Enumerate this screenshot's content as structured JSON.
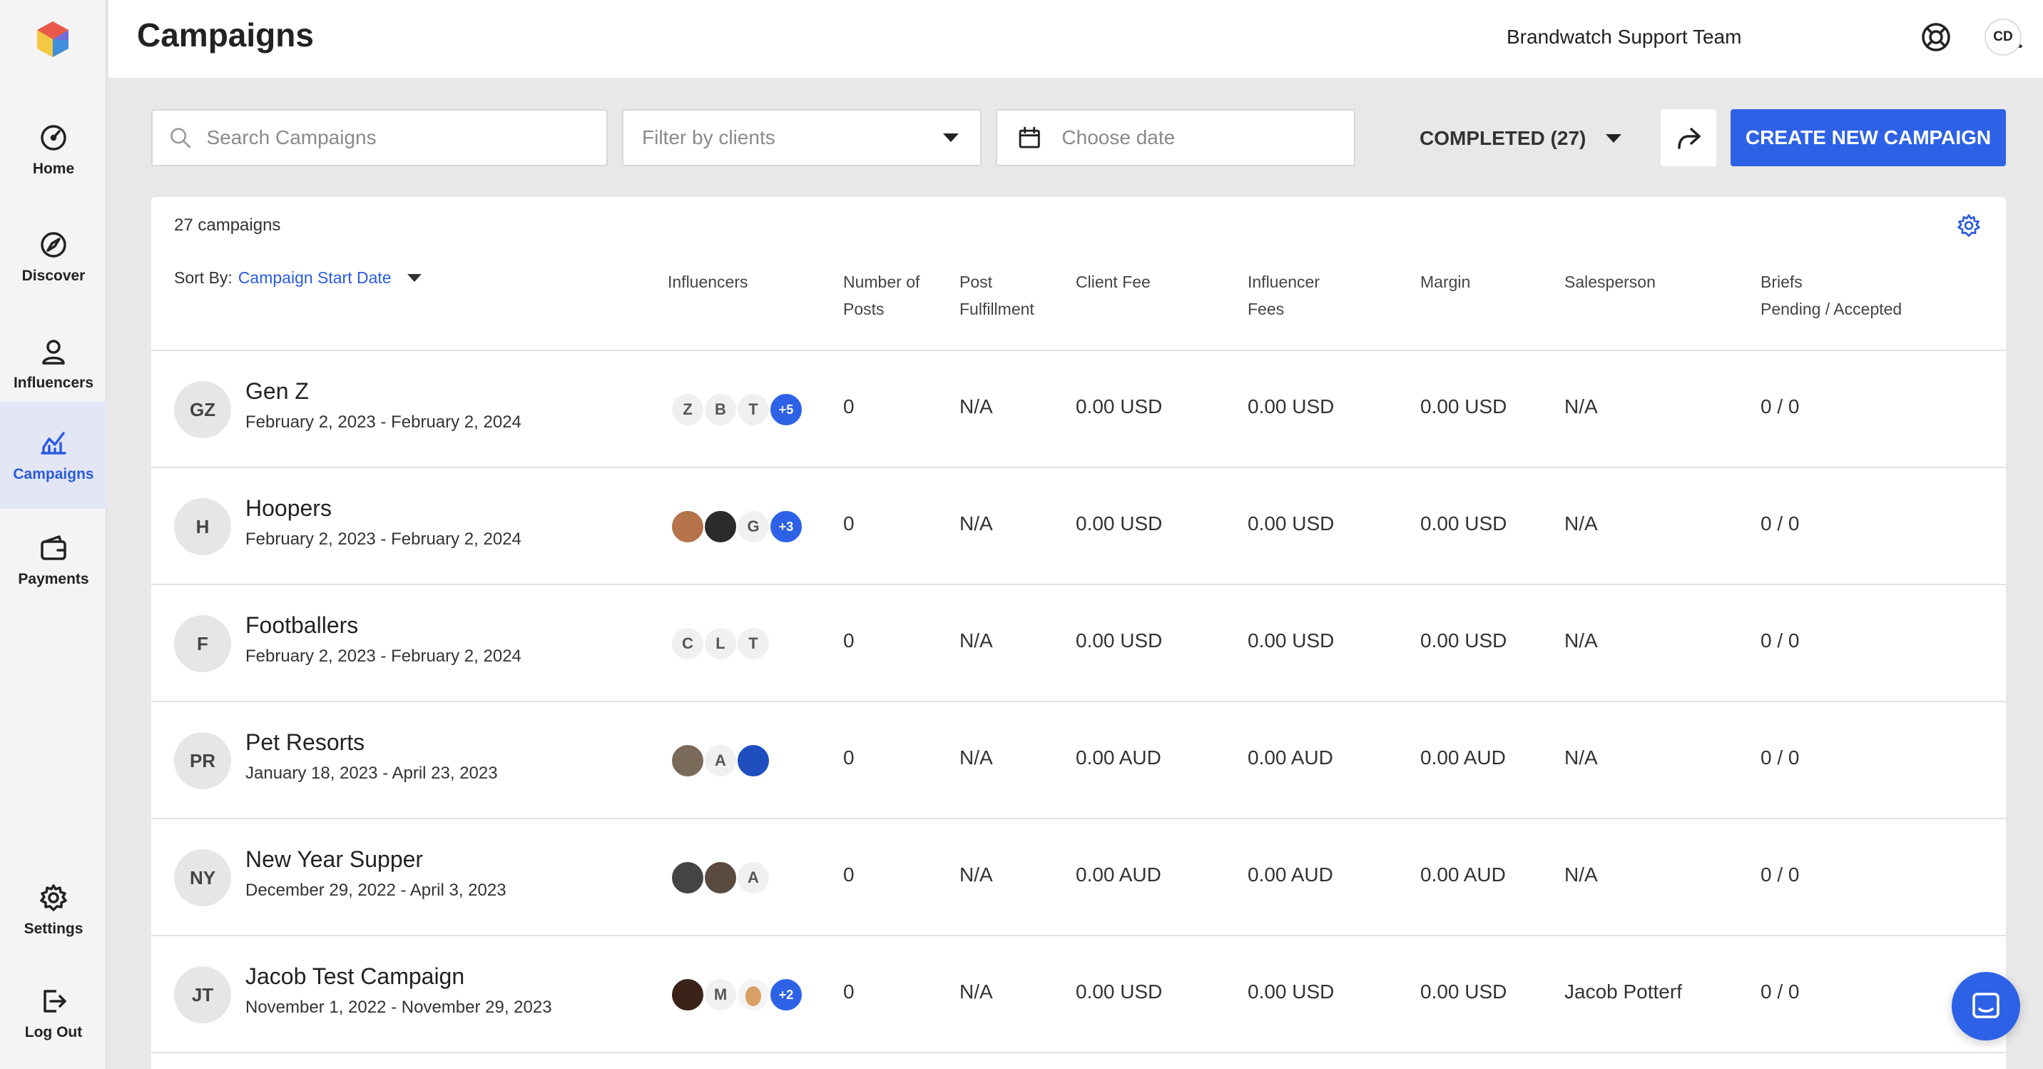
{
  "colors": {
    "accent": "#2e62e6",
    "sidebar_active_bg": "#e2e6f5"
  },
  "sidebar": {
    "items": [
      {
        "label": "Home",
        "icon": "home-icon"
      },
      {
        "label": "Discover",
        "icon": "discover-icon"
      },
      {
        "label": "Influencers",
        "icon": "influencers-icon"
      },
      {
        "label": "Campaigns",
        "icon": "campaigns-icon",
        "active": true
      },
      {
        "label": "Payments",
        "icon": "wallet-icon"
      },
      {
        "label": "Settings",
        "icon": "settings-icon"
      },
      {
        "label": "Log Out",
        "icon": "logout-icon"
      }
    ]
  },
  "header": {
    "title": "Campaigns",
    "team": "Brandwatch Support Team",
    "user_initials": "CD"
  },
  "filters": {
    "search_placeholder": "Search Campaigns",
    "client_placeholder": "Filter by clients",
    "date_placeholder": "Choose date",
    "status": "COMPLETED (27)",
    "create_label": "CREATE NEW CAMPAIGN"
  },
  "table": {
    "count": "27 campaigns",
    "sort_label": "Sort By:",
    "sort_value": "Campaign Start Date",
    "columns": {
      "influencers": "Influencers",
      "posts_1": "Number of",
      "posts_2": "Posts",
      "fulfill_1": "Post",
      "fulfill_2": "Fulfillment",
      "client_fee": "Client Fee",
      "infl_fees_1": "Influencer",
      "infl_fees_2": "Fees",
      "margin": "Margin",
      "salesperson": "Salesperson",
      "briefs_1": "Briefs",
      "briefs_2": "Pending / Accepted"
    },
    "rows": [
      {
        "initials": "GZ",
        "name": "Gen Z",
        "dates": "February 2, 2023 - February 2, 2024",
        "influencers": [
          "Z",
          "B",
          "T",
          "+5"
        ],
        "posts": "0",
        "fulfillment": "N/A",
        "client_fee": "0.00 USD",
        "influencer_fees": "0.00 USD",
        "margin": "0.00 USD",
        "salesperson": "N/A",
        "briefs": "0 / 0"
      },
      {
        "initials": "H",
        "name": "Hoopers",
        "dates": "February 2, 2023 - February 2, 2024",
        "influencers": [
          "",
          "",
          "G",
          "+3"
        ],
        "posts": "0",
        "fulfillment": "N/A",
        "client_fee": "0.00 USD",
        "influencer_fees": "0.00 USD",
        "margin": "0.00 USD",
        "salesperson": "N/A",
        "briefs": "0 / 0"
      },
      {
        "initials": "F",
        "name": "Footballers",
        "dates": "February 2, 2023 - February 2, 2024",
        "influencers": [
          "C",
          "L",
          "T"
        ],
        "posts": "0",
        "fulfillment": "N/A",
        "client_fee": "0.00 USD",
        "influencer_fees": "0.00 USD",
        "margin": "0.00 USD",
        "salesperson": "N/A",
        "briefs": "0 / 0"
      },
      {
        "initials": "PR",
        "name": "Pet Resorts",
        "dates": "January 18, 2023 - April 23, 2023",
        "influencers": [
          "",
          "A",
          ""
        ],
        "posts": "0",
        "fulfillment": "N/A",
        "client_fee": "0.00 AUD",
        "influencer_fees": "0.00 AUD",
        "margin": "0.00 AUD",
        "salesperson": "N/A",
        "briefs": "0 / 0"
      },
      {
        "initials": "NY",
        "name": "New Year Supper",
        "dates": "December 29, 2022 - April 3, 2023",
        "influencers": [
          "",
          "",
          "A"
        ],
        "posts": "0",
        "fulfillment": "N/A",
        "client_fee": "0.00 AUD",
        "influencer_fees": "0.00 AUD",
        "margin": "0.00 AUD",
        "salesperson": "N/A",
        "briefs": "0 / 0"
      },
      {
        "initials": "JT",
        "name": "Jacob Test Campaign",
        "dates": "November 1, 2022 - November 29, 2023",
        "influencers": [
          "",
          "M",
          "",
          "+2"
        ],
        "posts": "0",
        "fulfillment": "N/A",
        "client_fee": "0.00 USD",
        "influencer_fees": "0.00 USD",
        "margin": "0.00 USD",
        "salesperson": "Jacob Potterf",
        "briefs": "0 / 0"
      }
    ]
  }
}
